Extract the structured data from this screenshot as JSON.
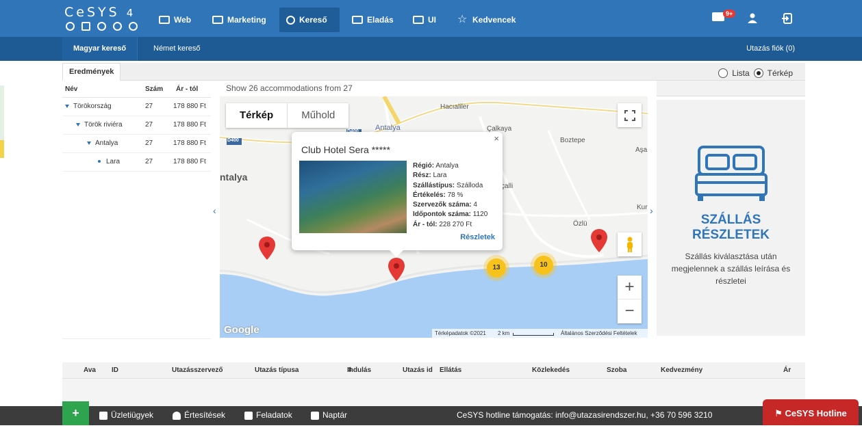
{
  "brand": {
    "name": "CeSYS",
    "version": "4"
  },
  "topnav": {
    "items": [
      {
        "label": "Web",
        "icon": "monitor-icon"
      },
      {
        "label": "Marketing",
        "icon": "mail-icon"
      },
      {
        "label": "Kereső",
        "icon": "search-icon",
        "active": true
      },
      {
        "label": "Eladás",
        "icon": "card-icon"
      },
      {
        "label": "UI",
        "icon": "grid-icon"
      },
      {
        "label": "Kedvencek",
        "icon": "star-icon"
      }
    ],
    "mail_badge": "9+"
  },
  "subnav": {
    "items": [
      {
        "label": "Magyar kereső",
        "active": true
      },
      {
        "label": "Német kereső"
      }
    ],
    "right": "Utazás fiók (0)"
  },
  "results": {
    "tab": "Eredmények",
    "view_options": {
      "list": "Lista",
      "map": "Térkép",
      "selected": "map"
    }
  },
  "tree": {
    "headers": {
      "name": "Név",
      "count": "Szám",
      "price": "Ár - tól"
    },
    "rows": [
      {
        "level": 0,
        "name": "Törökország",
        "count": "27",
        "price": "178 880 Ft"
      },
      {
        "level": 1,
        "name": "Török riviéra",
        "count": "27",
        "price": "178 880 Ft"
      },
      {
        "level": 2,
        "name": "Antalya",
        "count": "27",
        "price": "178 880 Ft"
      },
      {
        "level": 3,
        "name": "Lara",
        "count": "27",
        "price": "178 880 Ft"
      }
    ]
  },
  "map": {
    "summary": "Show 26 accommodations from 27",
    "type_map": "Térkép",
    "type_satellite": "Műhold",
    "labels": {
      "hacialiler": "Hacıaliler",
      "antalya_top": "Antalya",
      "calkaya": "Çalkaya",
      "boztepe": "Boztepe",
      "asag": "Aşa",
      "antalya_left": "ntalya",
      "cali": "çalli",
      "kur": "Kur",
      "ozlu": "Özlü",
      "d400a": "D400",
      "d400b": "D400"
    },
    "clusters": [
      "13",
      "10"
    ],
    "attribution": "Térképadatok ©2021",
    "scale": "2 km",
    "terms": "Általános Szerződési Feltételek",
    "google": "Google"
  },
  "popup": {
    "title": "Club Hotel Sera *****",
    "fields": [
      {
        "label": "Régió:",
        "value": "Antalya"
      },
      {
        "label": "Rész:",
        "value": "Lara"
      },
      {
        "label": "Szállástípus:",
        "value": "Szálloda"
      },
      {
        "label": "Értékelés:",
        "value": "78 %"
      },
      {
        "label": "Szervezők száma:",
        "value": "4"
      },
      {
        "label": "Időpontok száma:",
        "value": "1120"
      },
      {
        "label": "Ár - tól:",
        "value": "228 270 Ft"
      }
    ],
    "link": "Részletek",
    "close": "×"
  },
  "detail": {
    "title_line1": "SZÁLLÁS",
    "title_line2": "RÉSZLETEK",
    "text": "Szállás kiválasztása után megjelennek a szállás leírása és részletei"
  },
  "table": {
    "headers": [
      "Ava",
      "ID",
      "Utazásszervező",
      "Utazás típusa",
      "Indulás",
      "Utazás id",
      "Ellátás",
      "Közlekedés",
      "Szoba",
      "Kedvezmény",
      "Ár"
    ]
  },
  "footer": {
    "add": "+",
    "items": [
      "Üzletiügyek",
      "Értesítések",
      "Feladatok",
      "Naptár"
    ],
    "hotline_text": "CeSYS hotline támogatás: info@utazasirendszer.hu, +36 70 596 3210",
    "hotline_button": "CeSYS Hotline"
  },
  "colors": {
    "primary": "#2f75b7",
    "subnav": "#1e5b95",
    "accent_red": "#c62828",
    "pin": "#e53935",
    "cluster": "#f8c21c"
  }
}
